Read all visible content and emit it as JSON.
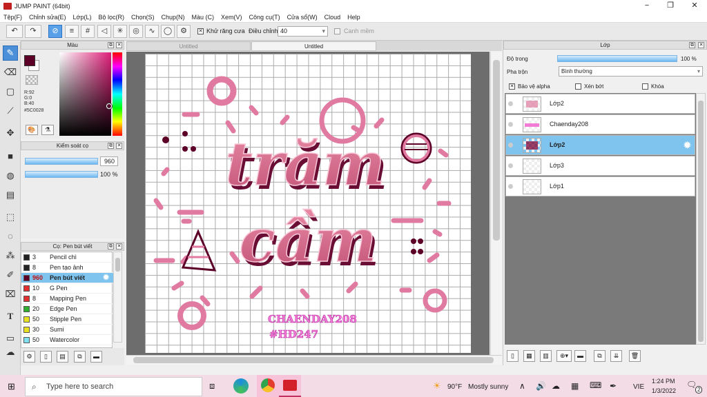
{
  "window": {
    "title": "JUMP PAINT (64bit)",
    "minimize": "−",
    "maximize": "❐",
    "close": "✕"
  },
  "menu": [
    "Tệp(F)",
    "Chỉnh sửa(E)",
    "Lớp(L)",
    "Bộ lọc(R)",
    "Chọn(S)",
    "Chụp(N)",
    "Màu (C)",
    "Xem(V)",
    "Công cụ(T)",
    "Cửa sổ(W)",
    "Cloud",
    "Help"
  ],
  "toolbar": {
    "antialias_label": "Khử răng cưa",
    "adjust_label": "Điều chỉnh",
    "adjust_value": "40",
    "snap_label": "Canh mềm"
  },
  "color_panel": {
    "title": "Màu",
    "r": "R:92",
    "g": "G:0",
    "b": "B:40",
    "hex": "#5C0028",
    "primary": "#5C0028"
  },
  "brush_control": {
    "title": "Kiểm soát cọ",
    "size": "960",
    "opacity": "100 %",
    "size_fill": 1.0,
    "opacity_fill": 1.0
  },
  "brush_panel": {
    "title": "Cọ: Pen bút viết",
    "items": [
      {
        "size": "3",
        "name": "Pencil chì",
        "color": "#222222"
      },
      {
        "size": "8",
        "name": "Pen tạo ảnh",
        "color": "#222222"
      },
      {
        "size": "960",
        "name": "Pen bút viết",
        "color": "#5C0028"
      },
      {
        "size": "10",
        "name": "G Pen",
        "color": "#e03030"
      },
      {
        "size": "8",
        "name": "Mapping Pen",
        "color": "#e03030"
      },
      {
        "size": "20",
        "name": "Edge Pen",
        "color": "#30b030"
      },
      {
        "size": "50",
        "name": "Stipple Pen",
        "color": "#e8e020"
      },
      {
        "size": "30",
        "name": "Sumi",
        "color": "#e8e020"
      },
      {
        "size": "50",
        "name": "Watercolor",
        "color": "#80e0f0"
      }
    ]
  },
  "document_tabs": [
    "Untitled",
    "Untitled"
  ],
  "canvas_art": {
    "line1": "trăm",
    "line2": "cầm",
    "sign1": "CHAENDAY208",
    "sign2": "#HD247"
  },
  "layer_panel": {
    "title": "Lớp",
    "opacity_label": "Độ trong",
    "opacity_value": "100 %",
    "opacity_fill": 1.0,
    "blend_label": "Pha trộn",
    "blend_value": "Bình thường",
    "protect_alpha": "Bảo vệ alpha",
    "clipping": "Xén bớt",
    "lock": "Khóa",
    "layers": [
      {
        "name": "Lớp2",
        "selected": false
      },
      {
        "name": "Chaenday208",
        "selected": false
      },
      {
        "name": "Lớp2",
        "selected": true
      },
      {
        "name": "Lớp3",
        "selected": false
      },
      {
        "name": "Lớp1",
        "selected": false
      }
    ]
  },
  "taskbar": {
    "search_placeholder": "Type here to search",
    "temp": "90°F",
    "weather": "Mostly sunny",
    "lang": "VIE",
    "time": "1:24 PM",
    "date": "1/3/2022",
    "notifications": "2"
  }
}
